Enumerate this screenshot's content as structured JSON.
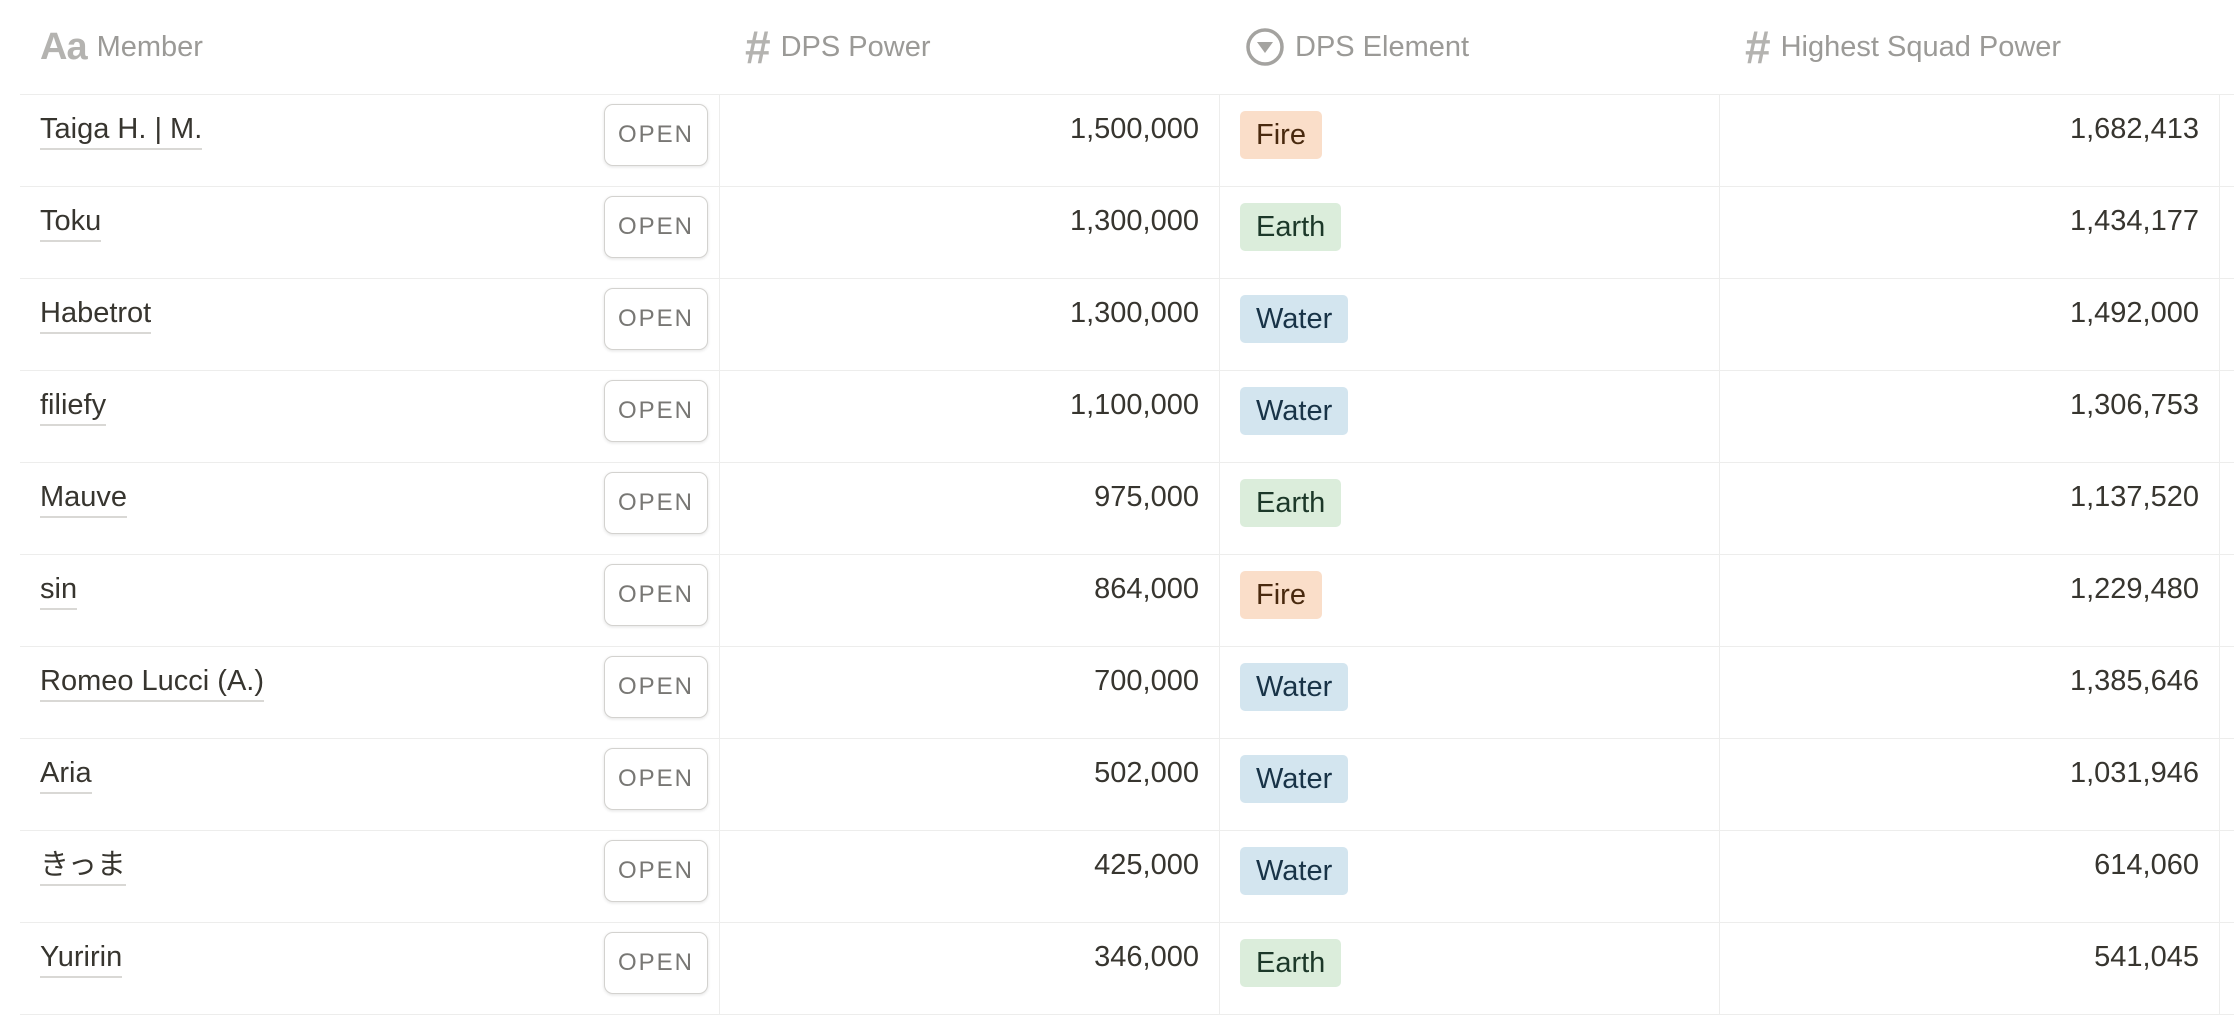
{
  "columns": {
    "member": {
      "label": "Member",
      "icon": "text-aa-icon"
    },
    "dps_power": {
      "label": "DPS Power",
      "icon": "number-hash-icon"
    },
    "dps_element": {
      "label": "DPS Element",
      "icon": "select-circle-icon"
    },
    "highest_squad_power": {
      "label": "Highest Squad Power",
      "icon": "number-hash-icon"
    }
  },
  "open_label": "OPEN",
  "element_colors": {
    "Fire": "#fadec9",
    "Earth": "#dbeddb",
    "Water": "#d3e5ef"
  },
  "rows": [
    {
      "member": "Taiga H. | M.",
      "dps_power": "1,500,000",
      "dps_element": "Fire",
      "highest_squad_power": "1,682,413"
    },
    {
      "member": "Toku",
      "dps_power": "1,300,000",
      "dps_element": "Earth",
      "highest_squad_power": "1,434,177"
    },
    {
      "member": "Habetrot",
      "dps_power": "1,300,000",
      "dps_element": "Water",
      "highest_squad_power": "1,492,000"
    },
    {
      "member": "filiefy",
      "dps_power": "1,100,000",
      "dps_element": "Water",
      "highest_squad_power": "1,306,753"
    },
    {
      "member": "Mauve",
      "dps_power": "975,000",
      "dps_element": "Earth",
      "highest_squad_power": "1,137,520"
    },
    {
      "member": "sin",
      "dps_power": "864,000",
      "dps_element": "Fire",
      "highest_squad_power": "1,229,480"
    },
    {
      "member": "Romeo Lucci (A.)",
      "dps_power": "700,000",
      "dps_element": "Water",
      "highest_squad_power": "1,385,646"
    },
    {
      "member": "Aria",
      "dps_power": "502,000",
      "dps_element": "Water",
      "highest_squad_power": "1,031,946"
    },
    {
      "member": "きっま",
      "dps_power": "425,000",
      "dps_element": "Water",
      "highest_squad_power": "614,060"
    },
    {
      "member": "Yuririn",
      "dps_power": "346,000",
      "dps_element": "Earth",
      "highest_squad_power": "541,045"
    }
  ]
}
